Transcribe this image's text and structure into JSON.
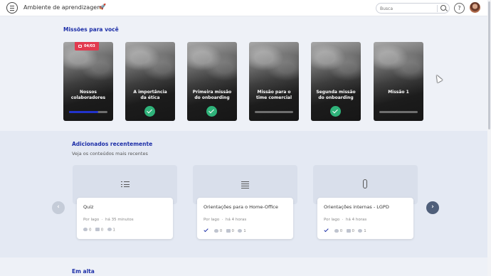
{
  "header": {
    "app_title": "Ambiente de aprendizagem",
    "search_placeholder": "Busca",
    "help_label": "?"
  },
  "missions": {
    "title": "Missões para você",
    "cards": [
      {
        "name": "Nossos\ncolaboradores",
        "badge": "04/03",
        "progress": 0.75,
        "completed": false
      },
      {
        "name": "A importância\nda ética",
        "completed": true
      },
      {
        "name": "Primeira missão\ndo onboarding",
        "completed": true
      },
      {
        "name": "Missão para o\ntime comercial",
        "progress": 0,
        "completed": false
      },
      {
        "name": "Segunda missão\ndo onboarding",
        "completed": true
      },
      {
        "name": "Missão 1",
        "progress": 0,
        "completed": false
      }
    ]
  },
  "recent": {
    "title": "Adicionados recentemente",
    "subtitle": "Veja os conteúdos mais recentes",
    "cards": [
      {
        "title": "Quiz",
        "author": "Por lago",
        "time": "há 35 minutos",
        "likes": "0",
        "comments": "0",
        "views": "1",
        "icon": "list-icon",
        "done": false
      },
      {
        "title": "Orientações para o Home-Office",
        "author": "Por lago",
        "time": "há 4 horas",
        "likes": "0",
        "comments": "0",
        "views": "1",
        "icon": "text-icon",
        "done": true
      },
      {
        "title": "Orientações internas - LGPD",
        "author": "Por lago",
        "time": "há 4 horas",
        "likes": "0",
        "comments": "0",
        "views": "1",
        "icon": "paperclip-icon",
        "done": true
      }
    ]
  },
  "trending": {
    "title": "Em alta"
  },
  "colors": {
    "accent": "#1d2fa8",
    "badge": "#e23a4f",
    "success": "#2fb37a"
  }
}
